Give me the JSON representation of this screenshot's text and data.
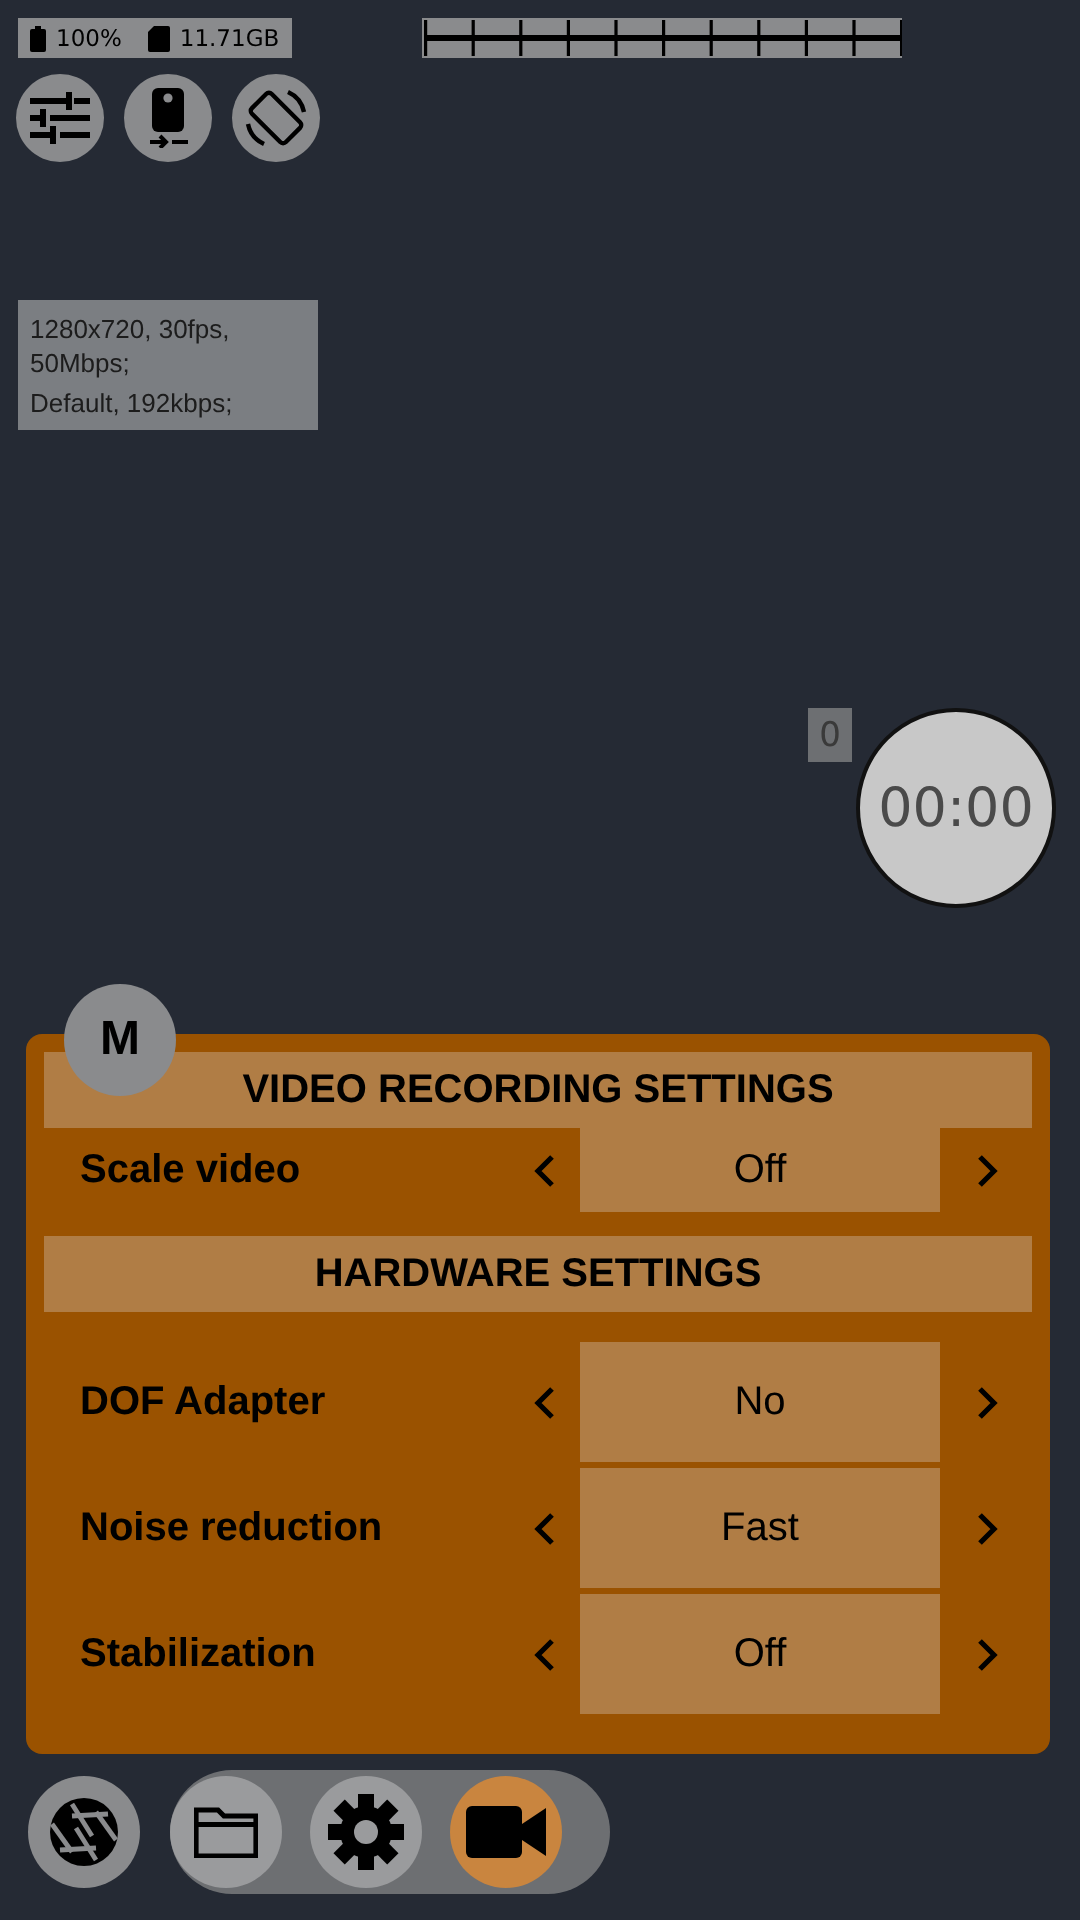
{
  "status": {
    "battery": "100%",
    "storage": "11.71GB"
  },
  "info": [
    "1280x720, 30fps, 50Mbps;",
    "Default, 192kbps;"
  ],
  "counter": "0",
  "timer": "00:00",
  "mode_button": "M",
  "settings": {
    "sections": [
      {
        "title": "VIDEO RECORDING SETTINGS",
        "rows": [
          {
            "label": "Scale video",
            "value": "Off"
          }
        ]
      },
      {
        "title": "HARDWARE SETTINGS",
        "rows": [
          {
            "label": "DOF Adapter",
            "value": "No"
          },
          {
            "label": "Noise reduction",
            "value": "Fast"
          },
          {
            "label": "Stabilization",
            "value": "Off"
          }
        ]
      }
    ]
  },
  "toolbar": [
    {
      "kind": "folder",
      "selected": false
    },
    {
      "kind": "settings",
      "selected": false
    },
    {
      "kind": "video",
      "selected": true
    }
  ]
}
